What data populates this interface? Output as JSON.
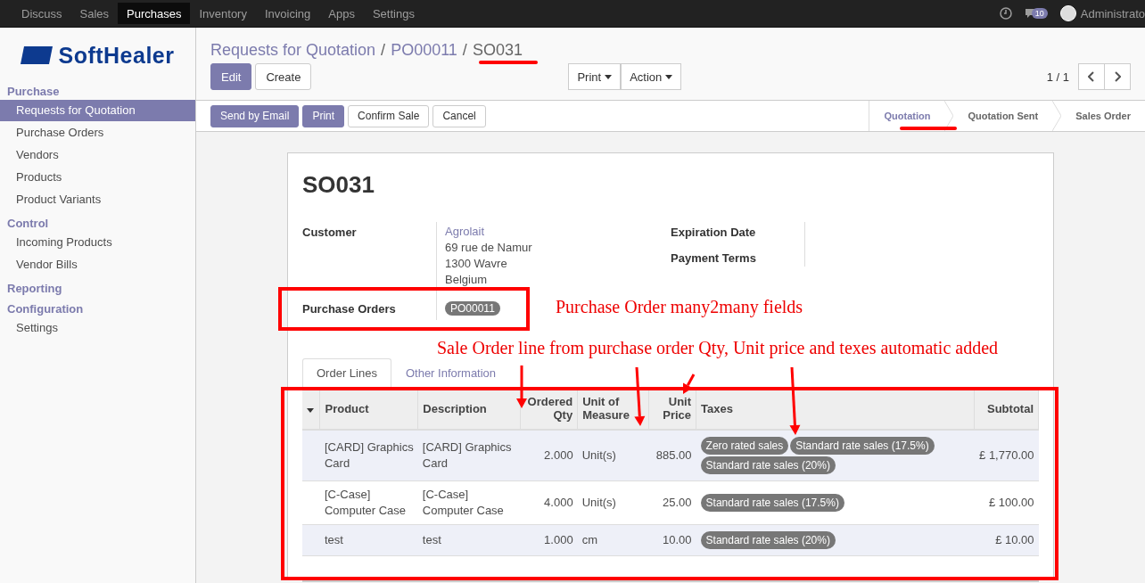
{
  "top_menu": [
    {
      "label": "Discuss",
      "selected": false
    },
    {
      "label": "Sales",
      "selected": false
    },
    {
      "label": "Purchases",
      "selected": true
    },
    {
      "label": "Inventory",
      "selected": false
    },
    {
      "label": "Invoicing",
      "selected": false
    },
    {
      "label": "Apps",
      "selected": false
    },
    {
      "label": "Settings",
      "selected": false
    }
  ],
  "systray": {
    "badge": "10",
    "user": "Administrato"
  },
  "logo": {
    "text": "SoftHealer"
  },
  "sidebar": [
    {
      "title": "Purchase",
      "items": [
        {
          "label": "Requests for Quotation",
          "selected": true
        },
        {
          "label": "Purchase Orders",
          "selected": false
        },
        {
          "label": "Vendors",
          "selected": false
        },
        {
          "label": "Products",
          "selected": false
        },
        {
          "label": "Product Variants",
          "selected": false
        }
      ]
    },
    {
      "title": "Control",
      "items": [
        {
          "label": "Incoming Products",
          "selected": false
        },
        {
          "label": "Vendor Bills",
          "selected": false
        }
      ]
    },
    {
      "title": "Reporting"
    },
    {
      "title": "Configuration",
      "items": [
        {
          "label": "Settings",
          "selected": false
        }
      ]
    }
  ],
  "breadcrumbs": [
    "Requests for Quotation",
    "PO00011",
    "SO031"
  ],
  "breadcrumb_separator": "/",
  "main_buttons": [
    {
      "label": "Edit",
      "kind": "primary"
    },
    {
      "label": "Create",
      "kind": "default"
    }
  ],
  "dropdowns": [
    "Print",
    "Action"
  ],
  "pager": "1 / 1",
  "header_buttons": [
    {
      "label": "Send by Email",
      "kind": "primary"
    },
    {
      "label": "Print",
      "kind": "primary"
    },
    {
      "label": "Confirm Sale",
      "kind": "default"
    },
    {
      "label": "Cancel",
      "kind": "default"
    }
  ],
  "status_steps": [
    {
      "label": "Quotation",
      "selected": true
    },
    {
      "label": "Quotation Sent",
      "selected": false
    },
    {
      "label": "Sales Order",
      "selected": false
    }
  ],
  "sheet": {
    "title": "SO031",
    "customer": {
      "label": "Customer",
      "name": "Agrolait",
      "address": [
        "69 rue de Namur",
        "1300 Wavre",
        "Belgium"
      ]
    },
    "right_fields": [
      "Expiration Date",
      "Payment Terms"
    ],
    "purchase_orders": {
      "label": "Purchase Orders",
      "tags": [
        "PO00011"
      ]
    },
    "tabs": [
      {
        "label": "Order Lines",
        "selected": true
      },
      {
        "label": "Other Information",
        "selected": false
      }
    ],
    "table": {
      "columns": [
        "Product",
        "Description",
        "Ordered Qty",
        "Unit of Measure",
        "Unit Price",
        "Taxes",
        "Subtotal"
      ],
      "rows": [
        {
          "product": "[CARD] Graphics Card",
          "description": "[CARD] Graphics Card",
          "qty": "2.000",
          "uom": "Unit(s)",
          "price": "885.00",
          "taxes": [
            "Zero rated sales",
            "Standard rate sales (17.5%)",
            "Standard rate sales (20%)"
          ],
          "subtotal": "£ 1,770.00"
        },
        {
          "product": "[C-Case] Computer Case",
          "description": "[C-Case] Computer Case",
          "qty": "4.000",
          "uom": "Unit(s)",
          "price": "25.00",
          "taxes": [
            "Standard rate sales (17.5%)"
          ],
          "subtotal": "£ 100.00"
        },
        {
          "product": "test",
          "description": "test",
          "qty": "1.000",
          "uom": "cm",
          "price": "10.00",
          "taxes": [
            "Standard rate sales (20%)"
          ],
          "subtotal": "£ 10.00"
        }
      ]
    }
  },
  "annotations": [
    "Purchase Order many2many fields",
    "Sale Order line from purchase order Qty, Unit price and texes automatic added"
  ]
}
